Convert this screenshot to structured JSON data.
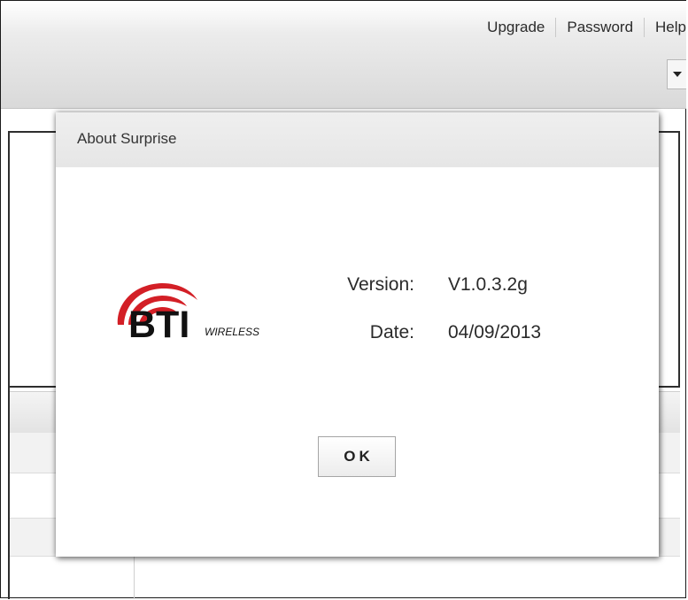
{
  "header": {
    "links": [
      {
        "label": "Upgrade"
      },
      {
        "label": "Password"
      },
      {
        "label": "Help"
      }
    ]
  },
  "dialog": {
    "title": "About Surprise",
    "logo": {
      "brand_text": "BTI",
      "sub_text": "WIRELESS",
      "brand_color": "#d31f26"
    },
    "version_label": "Version:",
    "version_value": "V1.0.3.2g",
    "date_label": "Date:",
    "date_value": "04/09/2013",
    "ok_label": "OK"
  }
}
